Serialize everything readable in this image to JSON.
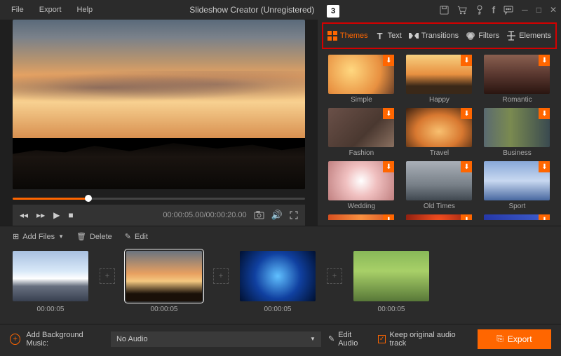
{
  "titlebar": {
    "menus": [
      "File",
      "Export",
      "Help"
    ],
    "title": "Slideshow Creator (Unregistered)"
  },
  "callout": "3",
  "tabs": {
    "items": [
      {
        "label": "Themes",
        "active": true
      },
      {
        "label": "Text",
        "active": false
      },
      {
        "label": "Transitions",
        "active": false
      },
      {
        "label": "Filters",
        "active": false
      },
      {
        "label": "Elements",
        "active": false
      }
    ]
  },
  "themes": [
    {
      "label": "Simple"
    },
    {
      "label": "Happy"
    },
    {
      "label": "Romantic"
    },
    {
      "label": "Fashion"
    },
    {
      "label": "Travel"
    },
    {
      "label": "Business"
    },
    {
      "label": "Wedding"
    },
    {
      "label": "Old Times"
    },
    {
      "label": "Sport"
    }
  ],
  "player": {
    "current": "00:00:05.00",
    "total": "00:00:20.00"
  },
  "toolbar": {
    "add_files": "Add Files",
    "delete": "Delete",
    "edit": "Edit"
  },
  "clips": [
    {
      "time": "00:00:05"
    },
    {
      "time": "00:00:05"
    },
    {
      "time": "00:00:05"
    },
    {
      "time": "00:00:05"
    }
  ],
  "footer": {
    "add_music": "Add Background Music:",
    "audio_select": "No Audio",
    "edit_audio": "Edit Audio",
    "keep_audio": "Keep original audio track",
    "export": "Export"
  }
}
